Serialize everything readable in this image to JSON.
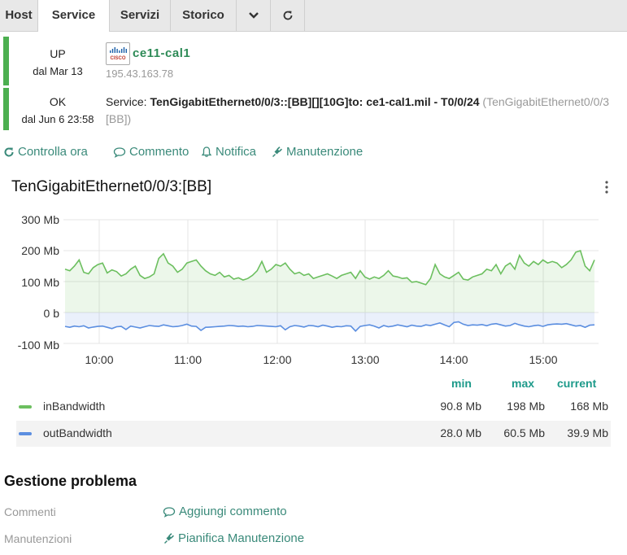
{
  "tabs": [
    {
      "label": "Host",
      "active": false
    },
    {
      "label": "Service",
      "active": true
    },
    {
      "label": "Servizi",
      "active": false
    },
    {
      "label": "Storico",
      "active": false
    }
  ],
  "tab_icons": [
    "chevron-down-icon",
    "refresh-icon"
  ],
  "host": {
    "state": "UP",
    "since": "dal Mar 13",
    "name": "ce11-cal1",
    "address": "195.43.163.78",
    "logo": "cisco-logo"
  },
  "service": {
    "state": "OK",
    "since": "dal Jun 6 23:58",
    "prefix": "Service:",
    "name": "TenGigabitEthernet0/0/3::[BB][][10G]to: ce1-cal1.mil - T0/0/24",
    "alias_start": "(TenGigabitEthernet0/0/3",
    "alias_end": "[BB])"
  },
  "actions": {
    "check_now": "Controlla ora",
    "comment": "Commento",
    "notification": "Notifica",
    "downtime": "Manutenzione"
  },
  "chart_data": {
    "type": "line",
    "title": "TenGigabitEthernet0/0/3:[BB]",
    "y_ticks": [
      "300 Mb",
      "200 Mb",
      "100 Mb",
      "0 b",
      "-100 Mb"
    ],
    "x_ticks": [
      "10:00",
      "11:00",
      "12:00",
      "13:00",
      "14:00",
      "15:00"
    ],
    "ylim": [
      -100,
      300
    ],
    "xlim": [
      "09:40",
      "15:40"
    ],
    "grid": true,
    "legend_headers": {
      "min": "min",
      "max": "max",
      "current": "current"
    },
    "series": [
      {
        "name": "inBandwidth",
        "color": "#6cbf5f",
        "min": "90.8 Mb",
        "max": "198 Mb",
        "current": "168 Mb",
        "values": [
          140,
          135,
          150,
          170,
          130,
          125,
          145,
          155,
          160,
          128,
          138,
          132,
          118,
          125,
          140,
          150,
          120,
          110,
          115,
          125,
          175,
          190,
          160,
          150,
          130,
          140,
          160,
          165,
          170,
          150,
          135,
          125,
          120,
          130,
          115,
          120,
          108,
          112,
          105,
          110,
          120,
          135,
          165,
          130,
          140,
          155,
          150,
          160,
          140,
          125,
          130,
          120,
          125,
          110,
          115,
          120,
          125,
          118,
          110,
          120,
          125,
          130,
          110,
          135,
          115,
          108,
          115,
          110,
          120,
          135,
          118,
          115,
          110,
          112,
          98,
          100,
          95,
          90,
          110,
          155,
          125,
          115,
          110,
          120,
          130,
          108,
          105,
          115,
          120,
          125,
          140,
          135,
          155,
          125,
          150,
          160,
          140,
          185,
          160,
          150,
          165,
          155,
          170,
          160,
          165,
          160,
          145,
          155,
          170,
          195,
          200,
          150,
          135,
          170
        ]
      },
      {
        "name": "outBandwidth",
        "color": "#5b8ee0",
        "min": "28.0 Mb",
        "max": "60.5 Mb",
        "current": "39.9 Mb",
        "values": [
          -45,
          -48,
          -44,
          -46,
          -43,
          -50,
          -47,
          -45,
          -44,
          -48,
          -52,
          -46,
          -45,
          -55,
          -44,
          -47,
          -50,
          -46,
          -42,
          -44,
          -45,
          -40,
          -43,
          -46,
          -45,
          -42,
          -38,
          -44,
          -45,
          -58,
          -48,
          -47,
          -46,
          -45,
          -44,
          -42,
          -43,
          -45,
          -44,
          -46,
          -45,
          -42,
          -43,
          -44,
          -45,
          -46,
          -43,
          -56,
          -46,
          -42,
          -44,
          -47,
          -42,
          -43,
          -46,
          -41,
          -44,
          -48,
          -45,
          -46,
          -43,
          -44,
          -60,
          -45,
          -42,
          -40,
          -44,
          -50,
          -42,
          -46,
          -44,
          -40,
          -43,
          -46,
          -41,
          -44,
          -45,
          -40,
          -42,
          -38,
          -34,
          -40,
          -46,
          -32,
          -30,
          -38,
          -42,
          -40,
          -41,
          -39,
          -43,
          -38,
          -36,
          -40,
          -44,
          -42,
          -35,
          -40,
          -44,
          -46,
          -43,
          -41,
          -45,
          -40,
          -38,
          -37,
          -38,
          -36,
          -40,
          -44,
          -42,
          -48,
          -41,
          -40
        ]
      }
    ]
  },
  "problem_mgmt": {
    "title": "Gestione problema",
    "comments_label": "Commenti",
    "comments_action": "Aggiungi commento",
    "downtimes_label": "Manutenzioni",
    "downtimes_action": "Pianifica Manutenzione"
  }
}
